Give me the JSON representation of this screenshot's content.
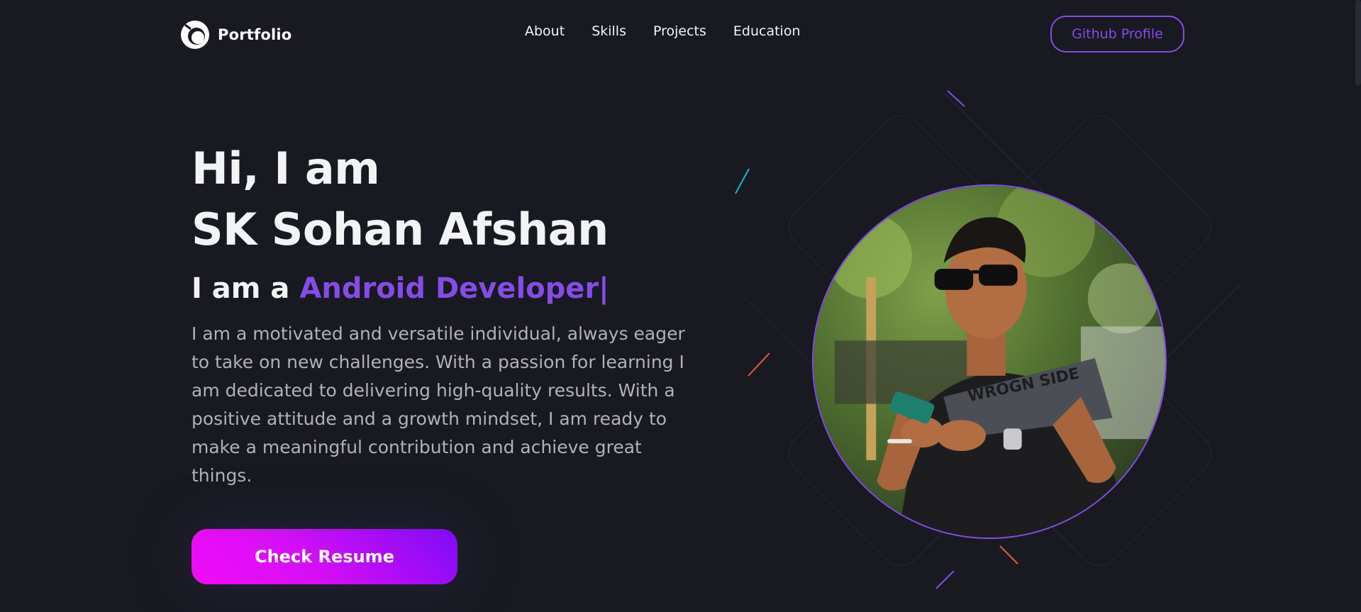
{
  "navbar": {
    "logo_text": "Portfolio",
    "links": [
      "About",
      "Skills",
      "Projects",
      "Education"
    ],
    "github_label": "Github Profile"
  },
  "hero": {
    "greeting": "Hi, I am",
    "name": "SK Sohan Afshan",
    "role_prefix": "I am a",
    "role_value": "Android Developer|",
    "bio": "I am a motivated and versatile individual, always eager to take on new challenges. With a passion for learning I am dedicated to delivering high-quality results. With a positive attitude and a growth mindset, I am ready to make a meaningful contribution and achieve great things.",
    "resume_label": "Check Resume",
    "photo_shirt_text": "WROGN SIDE"
  },
  "colors": {
    "background": "#191922",
    "primary": "#854ce6",
    "text": "#f2f3f4",
    "text_secondary": "#b1b2b3"
  }
}
